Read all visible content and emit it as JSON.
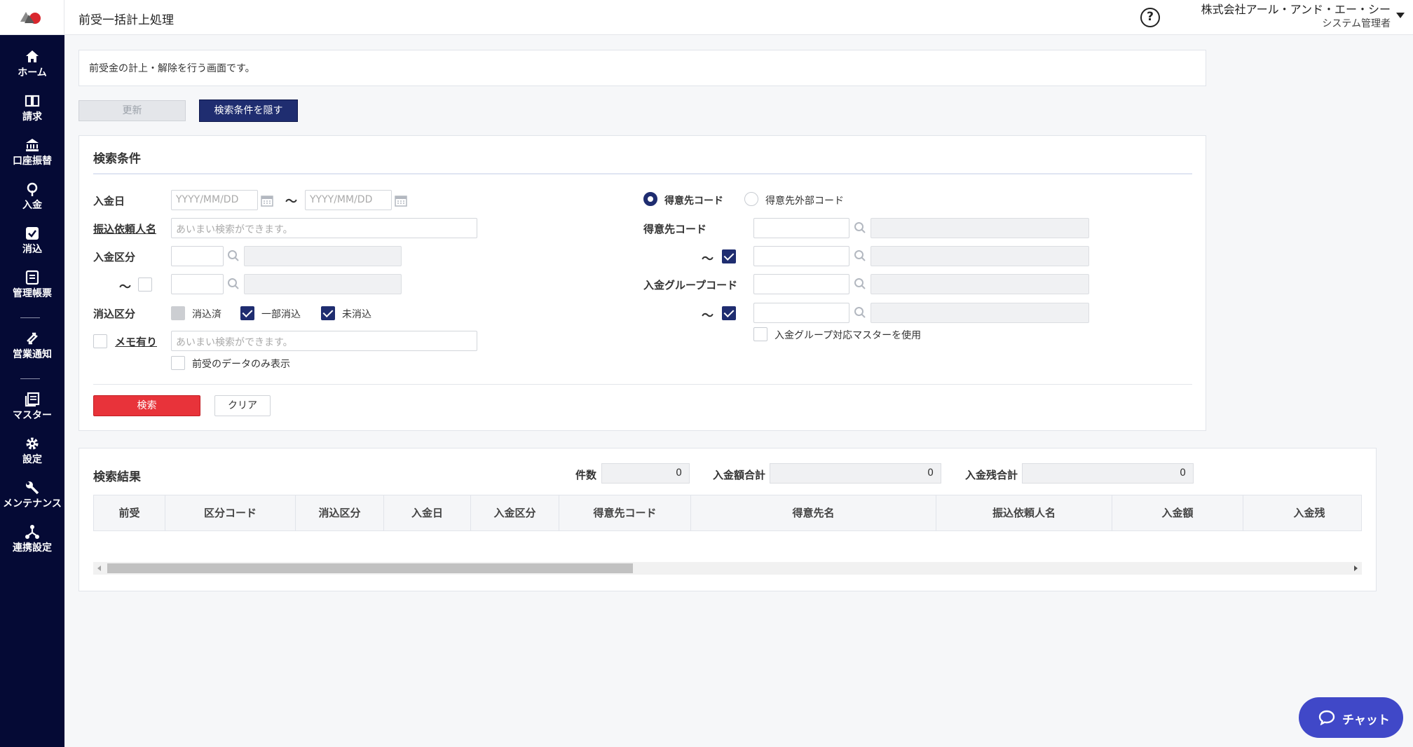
{
  "header": {
    "title": "前受一括計上処理",
    "company": "株式会社アール・アンド・エー・シー",
    "role": "システム管理者",
    "help_icon": "question-circle-icon"
  },
  "sidebar": {
    "items": [
      {
        "label": "ホーム",
        "icon": "home-icon"
      },
      {
        "label": "請求",
        "icon": "book-icon"
      },
      {
        "label": "口座振替",
        "icon": "bank-icon"
      },
      {
        "label": "入金",
        "icon": "coin-icon"
      },
      {
        "label": "消込",
        "icon": "check-square-icon"
      },
      {
        "label": "管理帳票",
        "icon": "report-icon"
      },
      {
        "label": "営業通知",
        "icon": "exchange-icon"
      },
      {
        "label": "マスター",
        "icon": "ledger-icon"
      },
      {
        "label": "設定",
        "icon": "gear-icon"
      },
      {
        "label": "メンテナンス",
        "icon": "wrench-icon"
      },
      {
        "label": "連携設定",
        "icon": "network-icon"
      }
    ]
  },
  "description": "前受金の計上・解除を行う画面です。",
  "toolbar": {
    "update_label": "更新",
    "hide_conditions_label": "検索条件を隠す"
  },
  "search": {
    "title": "検索条件",
    "deposit_date_label": "入金日",
    "date_placeholder": "YYYY/MM/DD",
    "tilde": "～",
    "transfer_requester_label": "振込依頼人名",
    "fuzzy_placeholder": "あいまい検索ができます。",
    "deposit_type_label": "入金区分",
    "reconcile_type_label": "消込区分",
    "reconcile_options": [
      {
        "label": "消込済",
        "checked": false,
        "disabled": true
      },
      {
        "label": "一部消込",
        "checked": true
      },
      {
        "label": "未消込",
        "checked": true
      }
    ],
    "memo_label": "メモ有り",
    "advance_only_label": "前受のデータのみ表示",
    "customer_code_radio": "得意先コード",
    "customer_external_radio": "得意先外部コード",
    "customer_code_label": "得意先コード",
    "deposit_group_label": "入金グループコード",
    "use_group_master_label": "入金グループ対応マスターを使用",
    "search_button": "検索",
    "clear_button": "クリア"
  },
  "results": {
    "title": "検索結果",
    "count_label": "件数",
    "count_value": "0",
    "amount_total_label": "入金額合計",
    "amount_total_value": "0",
    "balance_total_label": "入金残合計",
    "balance_total_value": "0",
    "columns": [
      "前受",
      "区分コード",
      "消込区分",
      "入金日",
      "入金区分",
      "得意先コード",
      "得意先名",
      "振込依頼人名",
      "入金額",
      "入金残"
    ]
  },
  "chat": {
    "label": "チャット",
    "icon": "chat-bubble-icon"
  },
  "colors": {
    "navy": "#1f2d70",
    "sidebar": "#050a35",
    "danger": "#e8333a",
    "chat": "#4048c8"
  }
}
